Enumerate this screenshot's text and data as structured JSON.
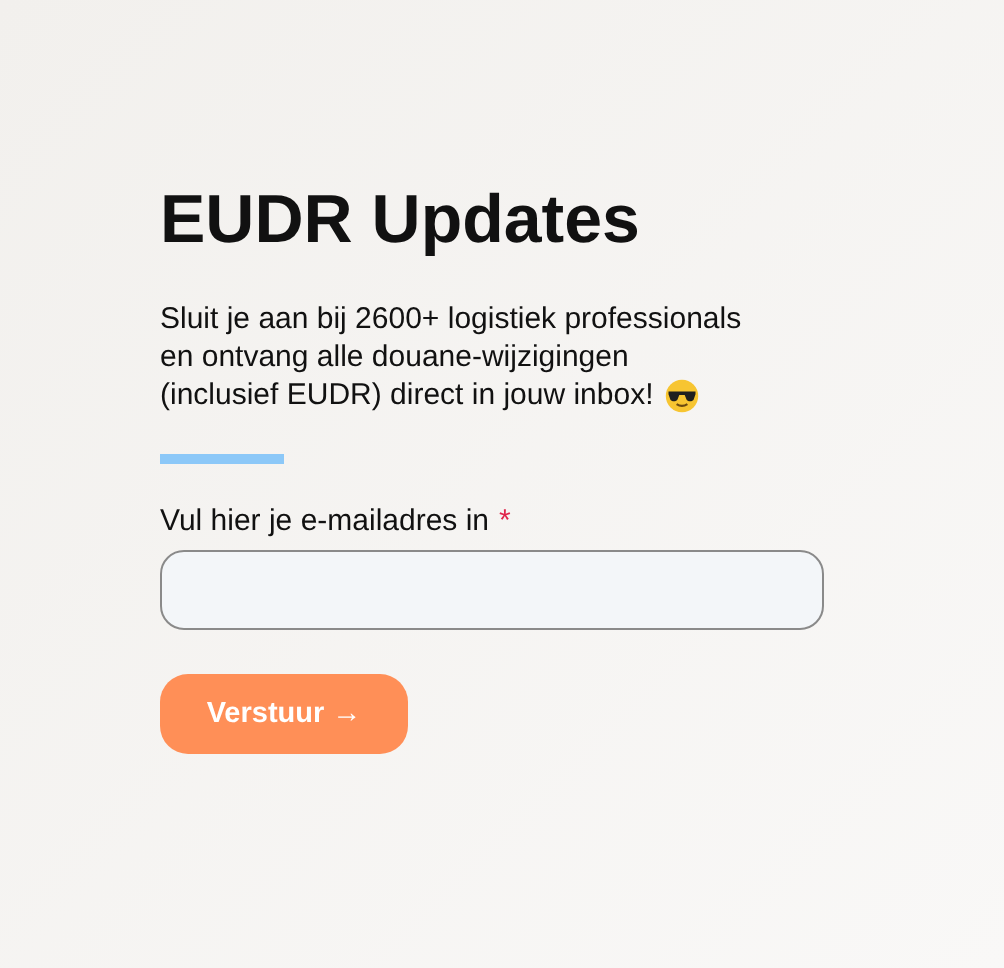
{
  "title": "EUDR Updates",
  "intro_lines": [
    "Sluit je aan bij 2600+ logistiek professionals",
    "en ontvang alle douane-wijzigingen",
    "(inclusief EUDR) direct in jouw inbox!"
  ],
  "email_field": {
    "label": "Vul hier je e-mailadres in",
    "required_mark": "*",
    "required": true
  },
  "submit_button": "Verstuur →"
}
